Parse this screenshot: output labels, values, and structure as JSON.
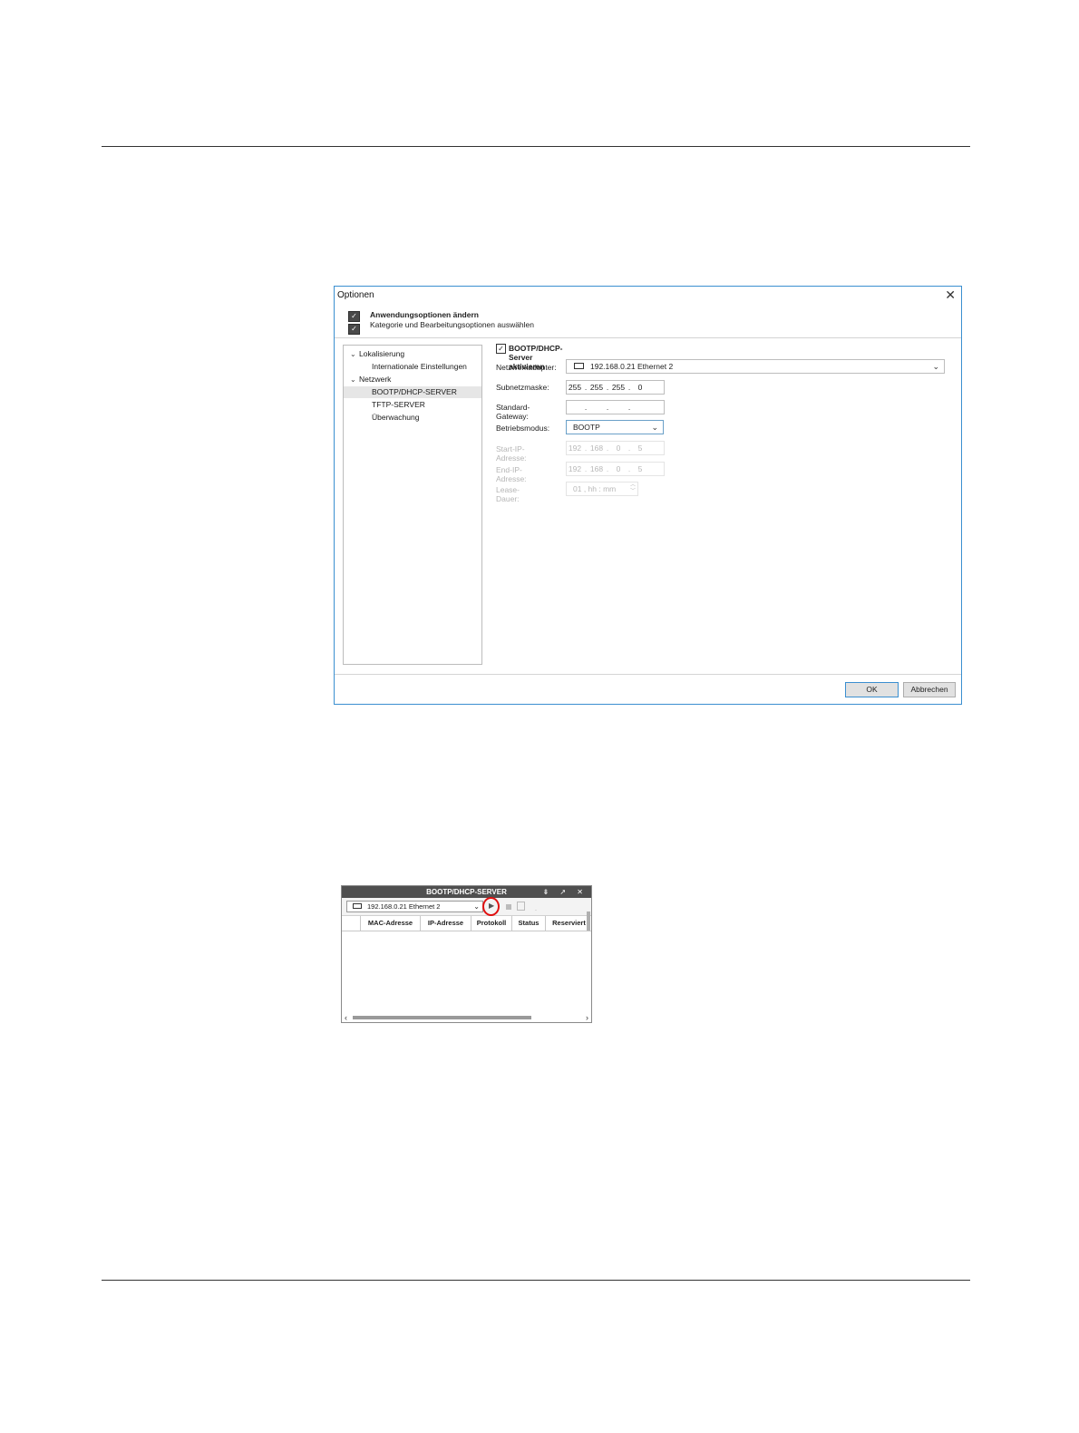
{
  "options_dialog": {
    "title": "Optionen",
    "header_title": "Anwendungsoptionen ändern",
    "header_subtitle": "Kategorie und Bearbeitungsoptionen auswählen",
    "tree": [
      {
        "label": "Lokalisierung",
        "level": 1,
        "expanded": true
      },
      {
        "label": "Internationale Einstellungen",
        "level": 2
      },
      {
        "label": "Netzwerk",
        "level": 1,
        "expanded": true
      },
      {
        "label": "BOOTP/DHCP-SERVER",
        "level": 2,
        "selected": true
      },
      {
        "label": "TFTP-SERVER",
        "level": 2
      },
      {
        "label": "Überwachung",
        "level": 2
      }
    ],
    "enable_label": "BOOTP/DHCP-Server aktivieren",
    "enable_checked": true,
    "netzwerkadapter_label": "Netzwerkadapter:",
    "netzwerkadapter_value": "192.168.0.21  Ethernet 2",
    "subnetzmaske_label": "Subnetzmaske:",
    "subnetzmaske": [
      "255",
      "255",
      "255",
      "0"
    ],
    "gateway_label": "Standard-Gateway:",
    "betriebsmodus_label": "Betriebsmodus:",
    "betriebsmodus_value": "BOOTP",
    "start_ip_label": "Start-IP-Adresse:",
    "start_ip": [
      "192",
      "168",
      "0",
      "5"
    ],
    "end_ip_label": "End-IP-Adresse:",
    "end_ip": [
      "192",
      "168",
      "0",
      "5"
    ],
    "lease_label": "Lease-Dauer:",
    "lease_value": "01 , hh : mm",
    "ok_label": "OK",
    "cancel_label": "Abbrechen"
  },
  "bootp_panel": {
    "title": "BOOTP/DHCP-SERVER",
    "title_icons": "⇟ ↗ ✕",
    "adapter_value": "192.168.0.21  Ethernet 2",
    "columns": [
      "MAC-Adresse",
      "IP-Adresse",
      "Protokoll",
      "Status",
      "Reserviert"
    ],
    "highlight_color": "#e01010"
  }
}
